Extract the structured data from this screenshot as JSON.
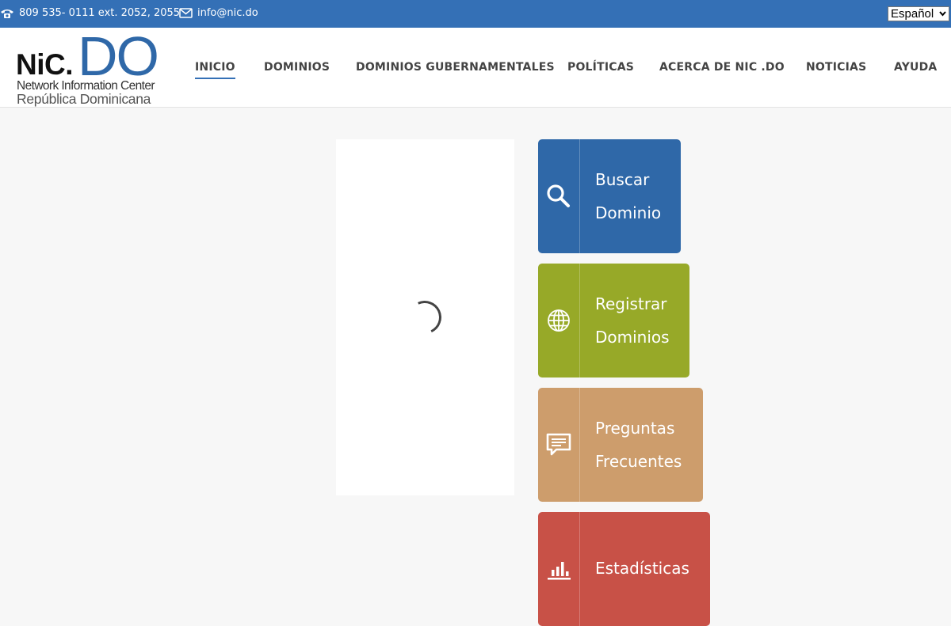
{
  "topbar": {
    "phone_icon": "phone-icon",
    "phone": "809 535- 0111 ext. 2052, 2055",
    "email_icon": "envelope-icon",
    "email": "info@nic.do",
    "language": "Español"
  },
  "logo": {
    "nic": "NiC.",
    "do": "DO",
    "line1": "Network Information Center",
    "line2": "República Dominicana"
  },
  "nav": {
    "items": [
      {
        "label": "INICIO",
        "active": true
      },
      {
        "label": "DOMINIOS"
      },
      {
        "label": "DOMINIOS GUBERNAMENTALES"
      },
      {
        "label": "POLÍTICAS"
      },
      {
        "label": "ACERCA DE NIC .DO"
      },
      {
        "label": "NOTICIAS"
      },
      {
        "label": "AYUDA"
      }
    ]
  },
  "tiles": [
    {
      "line1": "Buscar",
      "line2": "Dominio",
      "icon": "search-icon",
      "color": "#2f68a8"
    },
    {
      "line1": "Registrar",
      "line2": "Dominios",
      "icon": "globe-icon",
      "color": "#97a928"
    },
    {
      "line1": "Preguntas",
      "line2": "Frecuentes",
      "icon": "chat-icon",
      "color": "#cd9d6c"
    },
    {
      "line1": "Estadísticas",
      "line2": "",
      "icon": "bar-chart-icon",
      "color": "#c85147"
    }
  ],
  "colors": {
    "topbar": "#3470b6",
    "brand_blue": "#2f68a8",
    "page_bg": "#f7f7f7"
  }
}
